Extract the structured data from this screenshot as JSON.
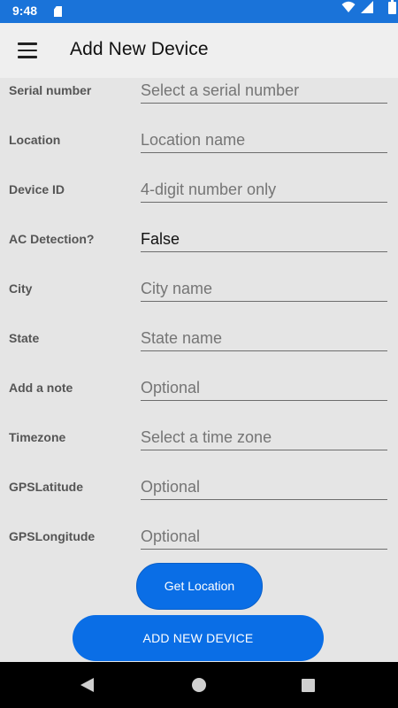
{
  "status_bar": {
    "time": "9:48"
  },
  "app_bar": {
    "title": "Add New Device",
    "menu_icon": "hamburger-menu-icon"
  },
  "form": {
    "serial_number": {
      "label": "Serial number",
      "placeholder": "Select a serial number"
    },
    "location": {
      "label": "Location",
      "placeholder": "Location name"
    },
    "device_id": {
      "label": "Device ID",
      "placeholder": "4-digit number only"
    },
    "ac_detection": {
      "label": "AC Detection?",
      "value": "False"
    },
    "city": {
      "label": "City",
      "placeholder": "City name"
    },
    "state": {
      "label": "State",
      "placeholder": "State name"
    },
    "note": {
      "label": "Add a note",
      "placeholder": "Optional"
    },
    "timezone": {
      "label": "Timezone",
      "placeholder": "Select a time zone"
    },
    "gps_latitude": {
      "label": "GPSLatitude",
      "placeholder": "Optional"
    },
    "gps_longitude": {
      "label": "GPSLongitude",
      "placeholder": "Optional"
    }
  },
  "buttons": {
    "get_location": "Get Location",
    "add_new_device": "ADD NEW DEVICE"
  },
  "colors": {
    "status_bar": "#1a73d9",
    "accent": "#0a6ee6",
    "background": "#e5e5e5",
    "app_bar": "#efefef"
  }
}
